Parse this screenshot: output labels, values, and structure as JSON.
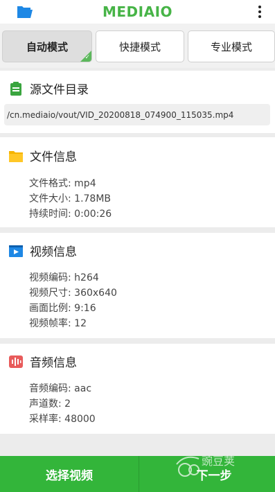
{
  "app": {
    "title": "MEDIAIO"
  },
  "icons": {
    "folder": "folder-open-icon",
    "menu": "more-vertical-icon"
  },
  "colors": {
    "accent": "#33b53a",
    "title_green": "#47b447",
    "folder_blue": "#1e88e5"
  },
  "modes": [
    {
      "label": "自动模式",
      "active": true
    },
    {
      "label": "快捷模式",
      "active": false
    },
    {
      "label": "专业模式",
      "active": false
    }
  ],
  "source": {
    "title": "源文件目录",
    "path": "/cn.mediaio/vout/VID_20200818_074900_115035.mp4"
  },
  "file_info": {
    "title": "文件信息",
    "lines": [
      "文件格式: mp4",
      "文件大小: 1.78MB",
      "持续时间: 0:00:26"
    ]
  },
  "video_info": {
    "title": "视频信息",
    "lines": [
      "视频编码: h264",
      "视频尺寸: 360x640",
      "画面比例: 9:16",
      "视频帧率: 12"
    ]
  },
  "audio_info": {
    "title": "音频信息",
    "lines": [
      "音频编码: aac",
      "声道数: 2",
      "采样率: 48000"
    ]
  },
  "actions": {
    "select_video": "选择视频",
    "next_step": "下一步"
  },
  "watermark": {
    "text": "豌豆荚"
  }
}
